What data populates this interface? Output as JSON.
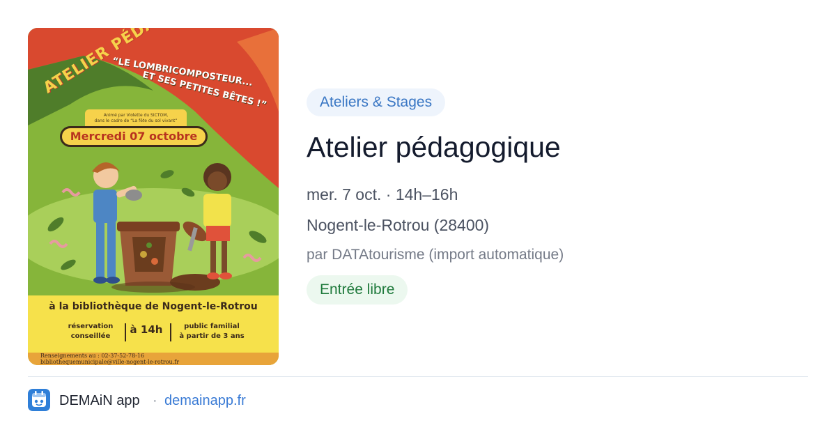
{
  "poster": {
    "title_arc": "ATELIER PÉDAGOGIQUE !",
    "subtitle_line1": "“LE LOMBRICOMPOSTEUR...",
    "subtitle_line2": "ET SES PETITES BÊTES !”",
    "credit_line1": "Animé par Violette du SICTOM,",
    "credit_line2": "dans le cadre de “La fête du sol vivant”",
    "date": "Mercredi 07 octobre",
    "venue": "à la bibliothèque de Nogent-le-Rotrou",
    "info_left_1": "réservation",
    "info_left_2": "conseillée",
    "info_time": "à 14h",
    "info_right_1": "public familial",
    "info_right_2": "à partir de 3 ans",
    "phone_line1": "Renseignements au : 02-37-52-78-16",
    "phone_line2": "bibliothequemunicipale@ville-nogent-le-rotrou.fr"
  },
  "category": "Ateliers & Stages",
  "title": "Atelier pédagogique",
  "datetime": "mer. 7 oct. · 14h–16h",
  "place": "Nogent-le-Rotrou (28400)",
  "source": "par DATAtourisme (import automatique)",
  "price": "Entrée libre",
  "footer": {
    "brand": "DEMAiN app",
    "separator": "·",
    "site": "demainapp.fr"
  },
  "colors": {
    "accent": "#3a77c4",
    "price_green": "#1f7a3c",
    "logo_blue": "#2f7fd8"
  }
}
